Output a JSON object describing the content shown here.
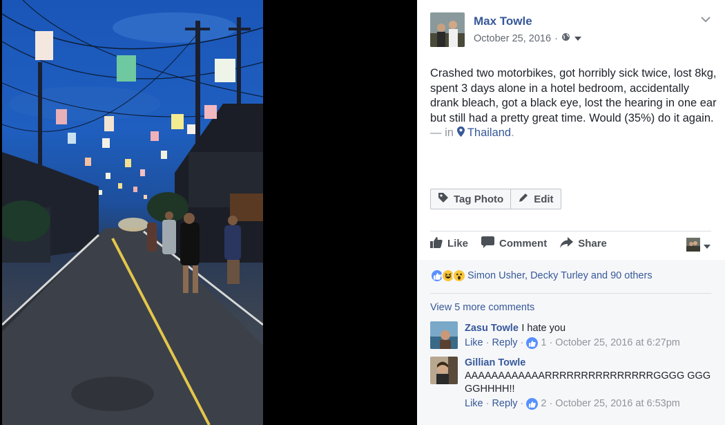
{
  "post": {
    "author": "Max Towle",
    "date": "October 25, 2016",
    "meta_sep": "·",
    "text": "Crashed two motorbikes, got horribly sick twice, lost 8kg, spent 3 days alone in a hotel bedroom, accidentally drank bleach, got a black eye, lost the hearing in one ear but still had a pretty great time. Would (35%) do it again.",
    "text_dash": " — in ",
    "location": "Thailand",
    "location_end": "."
  },
  "buttons": {
    "tag_photo": "Tag Photo",
    "edit": "Edit"
  },
  "actions": {
    "like": "Like",
    "comment": "Comment",
    "share": "Share"
  },
  "reactions": {
    "summary": "Simon Usher, Decky Turley and 90 others"
  },
  "comments_link": "View 5 more comments",
  "comments": [
    {
      "name": "Zasu Towle",
      "text": "I hate you",
      "like": "Like",
      "reply": "Reply",
      "like_count": "1",
      "time": "October 25, 2016 at 6:27pm"
    },
    {
      "name": "Gillian Towle",
      "text": "AAAAAAAAAAAARRRRRRRRRRRRRRRGGGG GGGGGHHHH!!",
      "like": "Like",
      "reply": "Reply",
      "like_count": "2",
      "time": "October 25, 2016 at 6:53pm"
    }
  ],
  "colors": {
    "link": "#365899",
    "text": "#1d2129",
    "meta": "#90949c",
    "like_blue": "#5890ff"
  },
  "icons": [
    "globe-icon",
    "caret-down-icon",
    "chevron-down-icon",
    "tag-icon",
    "pencil-icon",
    "thumbs-up-icon",
    "comment-icon",
    "share-icon",
    "location-pin-icon",
    "like-reaction-icon",
    "haha-reaction-icon",
    "wow-reaction-icon"
  ]
}
